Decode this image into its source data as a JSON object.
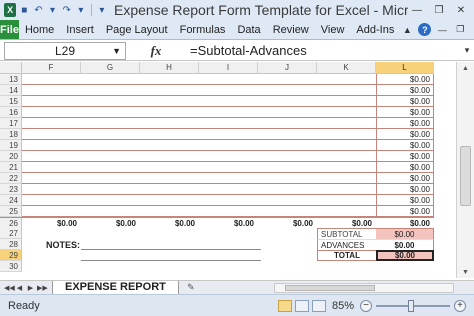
{
  "window": {
    "title": "Expense Report Form Template for Excel - Micr...",
    "app_icon": "X"
  },
  "ribbon": {
    "file_tab": "File",
    "tabs": [
      "Home",
      "Insert",
      "Page Layout",
      "Formulas",
      "Data",
      "Review",
      "View",
      "Add-Ins"
    ]
  },
  "formula_bar": {
    "name_box": "L29",
    "fx": "fx",
    "formula": "=Subtotal-Advances"
  },
  "grid": {
    "columns": [
      "F",
      "G",
      "H",
      "I",
      "J",
      "K",
      "L"
    ],
    "selected_column": "L",
    "selected_row": "29",
    "rows": [
      {
        "num": "13",
        "l": "$0.00"
      },
      {
        "num": "14",
        "l": "$0.00"
      },
      {
        "num": "15",
        "l": "$0.00"
      },
      {
        "num": "16",
        "l": "$0.00"
      },
      {
        "num": "17",
        "l": "$0.00"
      },
      {
        "num": "18",
        "l": "$0.00"
      },
      {
        "num": "19",
        "l": "$0.00"
      },
      {
        "num": "20",
        "l": "$0.00"
      },
      {
        "num": "21",
        "l": "$0.00"
      },
      {
        "num": "22",
        "l": "$0.00"
      },
      {
        "num": "23",
        "l": "$0.00"
      },
      {
        "num": "24",
        "l": "$0.00"
      },
      {
        "num": "25",
        "l": "$0.00"
      }
    ],
    "totals_row": {
      "num": "26",
      "values": [
        "$0.00",
        "$0.00",
        "$0.00",
        "$0.00",
        "$0.00",
        "$0.00",
        "$0.00"
      ]
    },
    "row27": {
      "num": "27",
      "label": "SUBTOTAL",
      "value": "$0.00"
    },
    "row28": {
      "num": "28",
      "notes": "NOTES:",
      "label": "ADVANCES",
      "value": "$0.00"
    },
    "row29": {
      "num": "29",
      "label": "TOTAL",
      "value": "$0.00"
    },
    "row30": {
      "num": "30"
    },
    "colors": {
      "subtotal_fill": "#f2c4bd",
      "total_fill": "#f2c4bd",
      "row_line": "#c4867a",
      "selection": "#f8d27a"
    }
  },
  "sheets": {
    "active": "EXPENSE REPORT"
  },
  "status": {
    "ready": "Ready",
    "zoom": "85%",
    "zoom_out": "−",
    "zoom_in": "+"
  }
}
